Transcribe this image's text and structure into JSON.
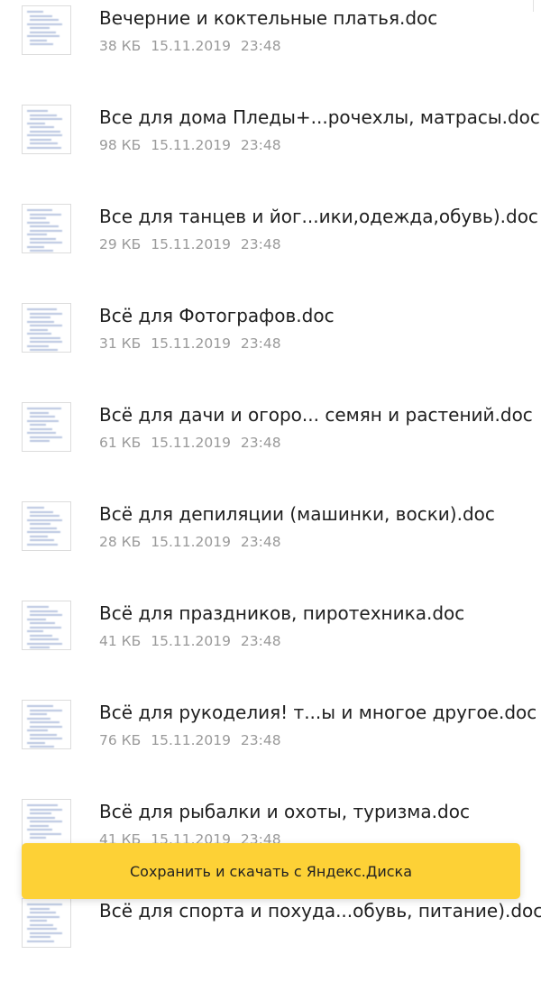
{
  "files": [
    {
      "name": "Вечерние и коктельные платья.doc",
      "size": "38 КБ",
      "date": "15.11.2019",
      "time": "23:48"
    },
    {
      "name": "Все для дома Пледы+...рочехлы, матрасы.doc",
      "size": "98 КБ",
      "date": "15.11.2019",
      "time": "23:48"
    },
    {
      "name": "Все для танцев и йог...ики,одежда,обувь).doc",
      "size": "29 КБ",
      "date": "15.11.2019",
      "time": "23:48"
    },
    {
      "name": "Всё для Фотографов.doc",
      "size": "31 КБ",
      "date": "15.11.2019",
      "time": "23:48"
    },
    {
      "name": "Всё для дачи и огоро... семян и растений.doc",
      "size": "61 КБ",
      "date": "15.11.2019",
      "time": "23:48"
    },
    {
      "name": "Всё для депиляции (машинки, воски).doc",
      "size": "28 КБ",
      "date": "15.11.2019",
      "time": "23:48"
    },
    {
      "name": "Всё для праздников, пиротехника.doc",
      "size": "41 КБ",
      "date": "15.11.2019",
      "time": "23:48"
    },
    {
      "name": "Всё для рукоделия! т...ы и многое другое.doc",
      "size": "76 КБ",
      "date": "15.11.2019",
      "time": "23:48"
    },
    {
      "name": "Всё для рыбалки и охоты, туризма.doc",
      "size": "41 КБ",
      "date": "15.11.2019",
      "time": "23:48"
    },
    {
      "name": "Всё для спорта и похуда...обувь, питание).doc",
      "size": "",
      "date": "",
      "time": ""
    }
  ],
  "save_button": {
    "label": "Сохранить и скачать с Яндекс.Диска"
  },
  "colors": {
    "accent": "#fdd136",
    "meta_text": "#9a9a9a",
    "name_text": "#202020"
  },
  "icons": {
    "file_thumbnail": "document-thumbnail-icon"
  }
}
